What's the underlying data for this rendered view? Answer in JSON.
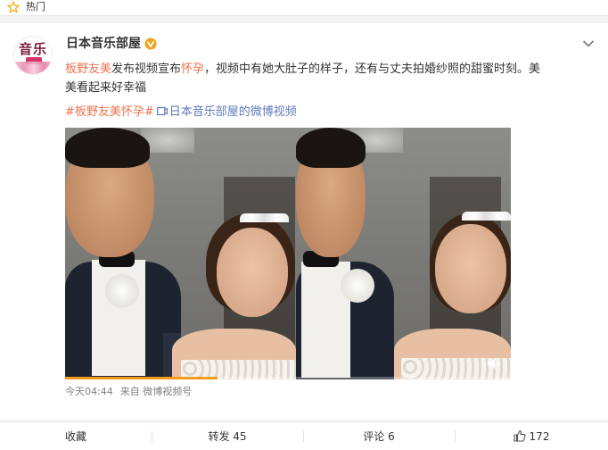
{
  "hot_bar": {
    "icon": "star-icon",
    "label": "热门"
  },
  "post": {
    "author": "日本音乐部屋",
    "avatar_text": "音乐",
    "vip_badge": "vip-badge-icon",
    "text_segments": [
      {
        "text": "板野友美",
        "highlight": true
      },
      {
        "text": "发布视频宣布",
        "highlight": false
      },
      {
        "text": "怀孕",
        "highlight": true
      },
      {
        "text": "，视频中有她大肚子的样子，还有与丈夫拍婚纱照的甜蜜时刻。美",
        "highlight": false
      }
    ],
    "text_line2": "美看起来好幸福",
    "topic_tag": "#板野友美怀孕#",
    "video_link": "日本音乐部屋的微博视频",
    "time": "今天04:44",
    "source": "来自 微博视频号",
    "video_progress": 0.342
  },
  "actions": {
    "favorite": "收藏",
    "repost": "转发 45",
    "comment": "评论 6",
    "like": "172"
  },
  "colors": {
    "highlight": "#eb7350",
    "link": "#5e7ab8",
    "progress": "#f49d1a"
  }
}
